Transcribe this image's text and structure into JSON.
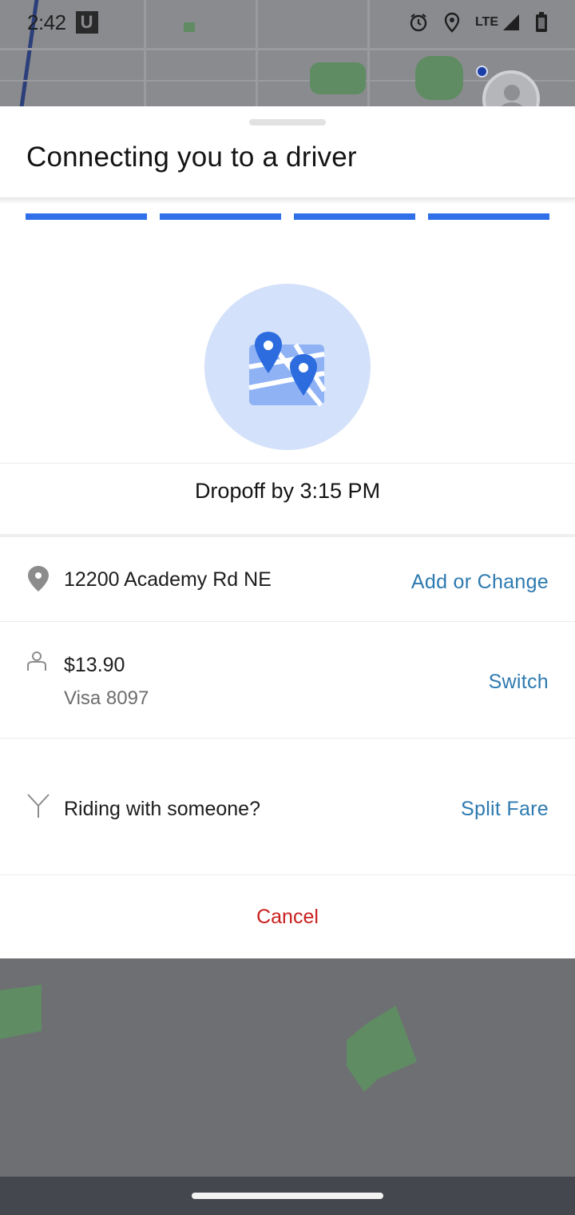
{
  "status_bar": {
    "time": "2:42",
    "app_badge": "U",
    "network": "LTE",
    "icons": [
      "alarm-icon",
      "location-icon",
      "signal-icon",
      "battery-icon"
    ]
  },
  "sheet": {
    "title": "Connecting you to a driver",
    "progress_segments": 4,
    "dropoff": "Dropoff by 3:15 PM",
    "destination": {
      "address": "12200 Academy Rd NE",
      "action": "Add or Change"
    },
    "payment": {
      "fare": "$13.90",
      "method": "Visa 8097",
      "action": "Switch"
    },
    "split": {
      "prompt": "Riding with someone?",
      "action": "Split Fare"
    },
    "cancel": "Cancel"
  },
  "colors": {
    "accent_blue": "#2f6fe8",
    "link": "#2d7ab0",
    "cancel_red": "#c9201e",
    "illustration_bg": "#d3e1fa"
  }
}
